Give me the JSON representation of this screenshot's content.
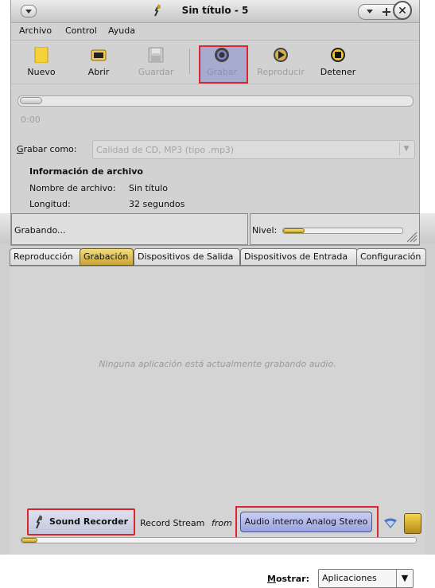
{
  "recorder": {
    "title": "Sin título - 5",
    "menu": {
      "archivo": "Archivo",
      "control": "Control",
      "ayuda": "Ayuda"
    },
    "toolbar": {
      "nuevo": "Nuevo",
      "abrir": "Abrir",
      "guardar": "Guardar",
      "grabar": "Grabar",
      "reproducir": "Reproducir",
      "detener": "Detener"
    },
    "time": "0:00",
    "grabar_como_label": "Grabar como:",
    "format_value": "Calidad de CD, MP3 (tipo .mp3)",
    "info": {
      "heading": "Información de archivo",
      "nombre_label": "Nombre de archivo:",
      "nombre_value": "Sin título",
      "longitud_label": "Longitud:",
      "longitud_value": "32 segundos"
    },
    "status": "Grabando...",
    "nivel_label": "Nivel:",
    "nivel_fraction": 0.18
  },
  "volume_control": {
    "tabs": [
      "Reproducción",
      "Grabación",
      "Dispositivos de Salida",
      "Dispositivos de Entrada",
      "Configuración"
    ],
    "active_tab": "Grabación",
    "empty_message": "Ninguna aplicación está actualmente grabando audio.",
    "stream": {
      "app_name": "Sound Recorder",
      "record_stream": "Record Stream",
      "from": "from",
      "source": "Audio interno Analog Stereo",
      "level_fraction": 0.04
    },
    "mostrar_label": "Mostrar:",
    "mostrar_value": "Aplicaciones"
  },
  "colors": {
    "highlight": "#d9262c",
    "accent": "#c9a225",
    "selected_button": "#a7abd0"
  },
  "icons": [
    "menu-icon",
    "shrink-grow-icon",
    "close-icon",
    "new-file-icon",
    "open-icon",
    "save-icon",
    "record-icon",
    "play-icon",
    "stop-icon",
    "microphone-icon",
    "network-icon",
    "config-icon",
    "resize-grip-icon"
  ]
}
